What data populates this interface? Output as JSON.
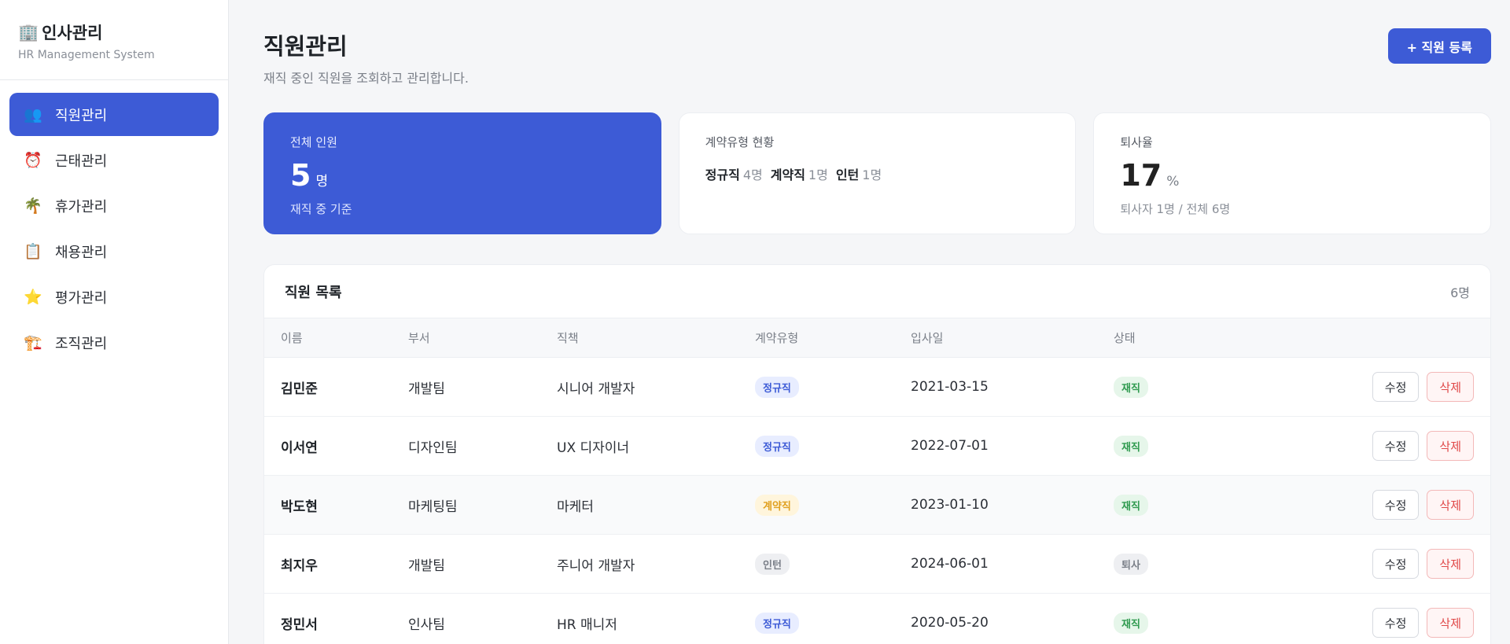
{
  "brand": {
    "icon": "building-icon",
    "title": "인사관리",
    "subtitle": "HR Management System"
  },
  "sidebar": {
    "items": [
      {
        "label": "직원관리",
        "icon": "👥",
        "active": true
      },
      {
        "label": "근태관리",
        "icon": "⏰",
        "active": false
      },
      {
        "label": "휴가관리",
        "icon": "🌴",
        "active": false
      },
      {
        "label": "채용관리",
        "icon": "📋",
        "active": false
      },
      {
        "label": "평가관리",
        "icon": "⭐",
        "active": false
      },
      {
        "label": "조직관리",
        "icon": "🏗️",
        "active": false
      }
    ]
  },
  "header": {
    "title": "직원관리",
    "subtitle": "재직 중인 직원을 조회하고 관리합니다.",
    "add_button": "+ 직원 등록"
  },
  "cards": {
    "total": {
      "label": "전체 인원",
      "value": "5",
      "unit": "명",
      "note": "재직 중 기준"
    },
    "contract": {
      "label": "계약유형 현황",
      "items": [
        {
          "type": "정규직",
          "count": "4명"
        },
        {
          "type": "계약직",
          "count": "1명"
        },
        {
          "type": "인턴",
          "count": "1명"
        }
      ]
    },
    "turnover": {
      "label": "퇴사율",
      "value": "17",
      "unit": "%",
      "note": "퇴사자 1명 / 전체 6명"
    }
  },
  "table": {
    "title": "직원 목록",
    "count": "6명",
    "columns": [
      "이름",
      "부서",
      "직책",
      "계약유형",
      "입사일",
      "상태",
      ""
    ],
    "edit_label": "수정",
    "delete_label": "삭제",
    "rows": [
      {
        "name": "김민준",
        "dept": "개발팀",
        "position": "시니어 개발자",
        "contract": "정규직",
        "date": "2021-03-15",
        "status": "재직"
      },
      {
        "name": "이서연",
        "dept": "디자인팀",
        "position": "UX 디자이너",
        "contract": "정규직",
        "date": "2022-07-01",
        "status": "재직"
      },
      {
        "name": "박도현",
        "dept": "마케팅팀",
        "position": "마케터",
        "contract": "계약직",
        "date": "2023-01-10",
        "status": "재직"
      },
      {
        "name": "최지우",
        "dept": "개발팀",
        "position": "주니어 개발자",
        "contract": "인턴",
        "date": "2024-06-01",
        "status": "퇴사"
      },
      {
        "name": "정민서",
        "dept": "인사팀",
        "position": "HR 매니저",
        "contract": "정규직",
        "date": "2020-05-20",
        "status": "재직"
      }
    ]
  },
  "colors": {
    "accent": "#3d5bd6",
    "danger": "#e04848",
    "success": "#2f9a4f"
  }
}
